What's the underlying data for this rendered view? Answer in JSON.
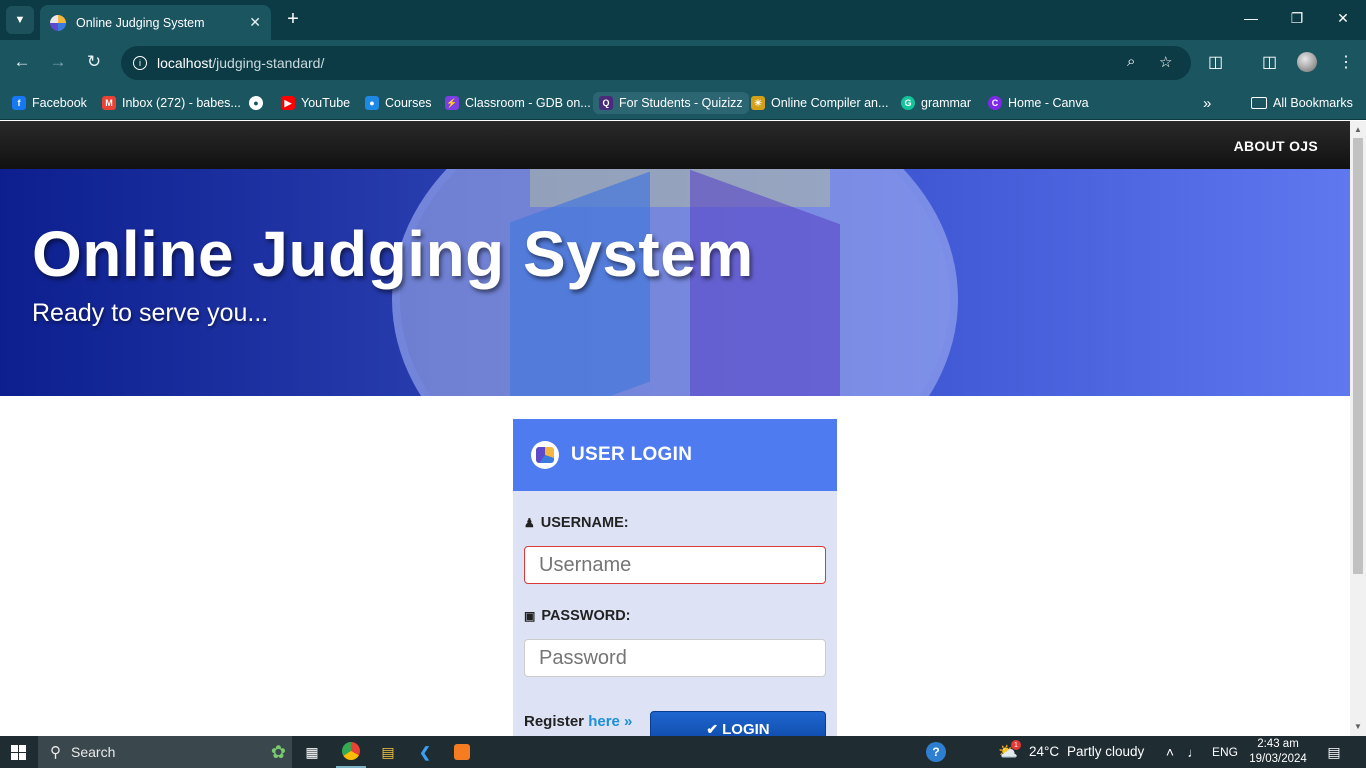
{
  "browser": {
    "tab_title": "Online Judging System",
    "url_host": "localhost",
    "url_path": "/judging-standard/",
    "bookmarks": [
      {
        "label": "Facebook",
        "icon": "facebook-icon",
        "color": "#1877f2"
      },
      {
        "label": "Inbox (272) - babes...",
        "icon": "gmail-icon",
        "color": "#ea4335"
      },
      {
        "label": "",
        "icon": "globe-icon",
        "color": "#1a5560"
      },
      {
        "label": "YouTube",
        "icon": "youtube-icon",
        "color": "#ff0000"
      },
      {
        "label": "Courses",
        "icon": "classroom-icon",
        "color": "#1e88e5"
      },
      {
        "label": "Classroom - GDB on...",
        "icon": "gdb-icon",
        "color": "#7b3fe4"
      },
      {
        "label": "For Students - Quizizz",
        "icon": "quizizz-icon",
        "color": "#4a2a7a"
      },
      {
        "label": "Online Compiler an...",
        "icon": "compiler-icon",
        "color": "#d4a017"
      },
      {
        "label": "grammar",
        "icon": "grammarly-icon",
        "color": "#15c39a"
      },
      {
        "label": "Home - Canva",
        "icon": "canva-icon",
        "color": "#7d2ae8"
      }
    ],
    "all_bookmarks_label": "All Bookmarks"
  },
  "site": {
    "nav_about": "ABOUT OJS",
    "hero_title": "Online Judging System",
    "hero_subtitle": "Ready to serve you..."
  },
  "login": {
    "title": "USER LOGIN",
    "username_label": "USERNAME:",
    "username_placeholder": "Username",
    "password_label": "PASSWORD:",
    "password_placeholder": "Password",
    "register_text": "Register",
    "register_link": "here »",
    "button_label": "LOGIN"
  },
  "taskbar": {
    "search_label": "Search",
    "weather_temp": "24°C",
    "weather_desc": "Partly cloudy",
    "language": "ENG",
    "time": "2:43 am",
    "date": "19/03/2024",
    "weather_badge": "1"
  },
  "colors": {
    "chrome_bg": "#1a5560",
    "login_header": "#4e7cf0",
    "login_button": "#0c47a5",
    "hero_start": "#0d1f8f",
    "hero_end": "#5f78f0"
  }
}
